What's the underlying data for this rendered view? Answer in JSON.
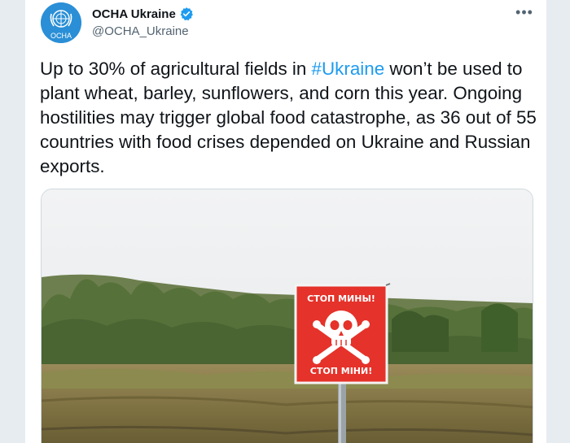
{
  "account": {
    "display_name": "OCHA Ukraine",
    "handle": "@OCHA_Ukraine",
    "avatar_label": "OCHA",
    "verified": true
  },
  "tweet": {
    "text_before": "Up to 30% of agricultural fields in ",
    "hashtag": "#Ukraine",
    "text_after": " won’t be used to plant wheat, barley, sunflowers, and corn this year. Ongoing hostilities may trigger global food catastrophe, as 36 out of 55 countries with food crises depended on Ukraine and Russian exports."
  },
  "media": {
    "sign_top": "СТОП МИНЫ!",
    "sign_bottom": "СТОП МІНИ!"
  },
  "menu": {
    "more_label": "•••"
  },
  "colors": {
    "link": "#1d9bf0",
    "avatar_bg": "#2a8fd6",
    "sign_red": "#e5322a",
    "verified": "#1d9bf0"
  }
}
